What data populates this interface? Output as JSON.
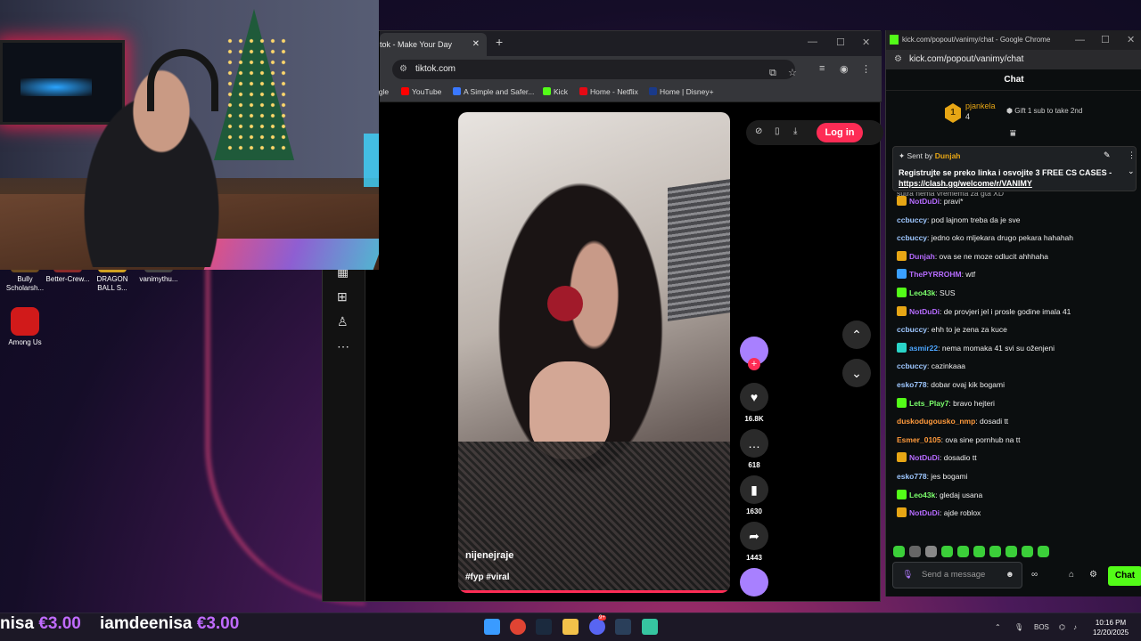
{
  "desktop": {
    "icons": [
      {
        "label": "Bully Scholarsh...",
        "color": "#6b4a1f"
      },
      {
        "label": "Better-Crew...",
        "color": "#8a2a2a"
      },
      {
        "label": "DRAGON BALL S...",
        "color": "#d0a020"
      },
      {
        "label": "vanimythu...",
        "color": "#444"
      },
      {
        "label": "Among Us",
        "color": "#d11a1a"
      }
    ]
  },
  "tiktok_browser": {
    "tab_title": "tok - Make Your Day",
    "url": "tiktok.com",
    "bookmarks": [
      "ogle",
      "YouTube",
      "A Simple and Safer...",
      "Kick",
      "Home - Netflix",
      "Home | Disney+"
    ],
    "login_label": "Log in",
    "video": {
      "username": "nijenejraje",
      "hashtags": "#fyp #viral"
    },
    "counts": {
      "likes": "16.8K",
      "comments": "618",
      "saves": "1630",
      "shares": "1443"
    }
  },
  "chat_window": {
    "window_title": "kick.com/popout/vanimy/chat - Google Chrome",
    "url": "kick.com/popout/vanimy/chat",
    "heading": "Chat",
    "leaderboard": {
      "rank": "1",
      "name": "pjankela",
      "count": "4",
      "gift_text": "Gift 1 sub to take 2nd"
    },
    "pinned": {
      "sent_by_label": "Sent by",
      "sender": "Dunjah",
      "message": "Registrujte se preko linka i osvojite 3 FREE CS CASES",
      "link_prefix": "- ",
      "link": "https://clash.gg/welcome/r/VANIMY"
    },
    "partial_line": "sutra nema vremema za gta XD",
    "messages": [
      {
        "user": "NotDuDi",
        "color": "#b66bff",
        "badge": "#e7a615",
        "text": ": pravi*"
      },
      {
        "user": "ccbuccy",
        "color": "#9ec7ff",
        "badge": "",
        "text": ": pod lajnom treba da je sve"
      },
      {
        "user": "ccbuccy",
        "color": "#9ec7ff",
        "badge": "",
        "text": ": jedno oko mljekara drugo pekara hahahah"
      },
      {
        "user": "Dunjah",
        "color": "#b66bff",
        "badge": "#e7a615",
        "text": ": ova se ne moze odlucit ahhhaha"
      },
      {
        "user": "ThePYRROHM",
        "color": "#b66bff",
        "badge": "#3aa0ff",
        "text": ": wtf"
      },
      {
        "user": "Leo43k",
        "color": "#7bff6b",
        "badge": "#53fc18",
        "text": ": SUS"
      },
      {
        "user": "NotDuDi",
        "color": "#b66bff",
        "badge": "#e7a615",
        "text": ": de provjeri jel i prosle godine imala 41"
      },
      {
        "user": "ccbuccy",
        "color": "#9ec7ff",
        "badge": "",
        "text": ": ehh to je zena za kuce"
      },
      {
        "user": "asmir22",
        "color": "#4da6ff",
        "badge": "#2ad4c8",
        "text": ": nema momaka 41 svi su oženjeni"
      },
      {
        "user": "ccbuccy",
        "color": "#9ec7ff",
        "badge": "",
        "text": ": cazinkaaa"
      },
      {
        "user": "esko778",
        "color": "#9ec7ff",
        "badge": "",
        "text": ": dobar ovaj kik bogami"
      },
      {
        "user": "Lets_Play7",
        "color": "#7bff6b",
        "badge": "#53fc18",
        "text": ": bravo hejteri"
      },
      {
        "user": "duskodugousko_nmp",
        "color": "#ff9a3c",
        "badge": "",
        "text": ": dosadi tt"
      },
      {
        "user": "Esmer_0105",
        "color": "#ff9a3c",
        "badge": "",
        "text": ": ova sine pornhub na tt"
      },
      {
        "user": "NotDuDi",
        "color": "#b66bff",
        "badge": "#e7a615",
        "text": ": dosadio tt"
      },
      {
        "user": "esko778",
        "color": "#9ec7ff",
        "badge": "",
        "text": ": jes bogami"
      },
      {
        "user": "Leo43k",
        "color": "#7bff6b",
        "badge": "#53fc18",
        "text": ": gledaj usana"
      },
      {
        "user": "NotDuDi",
        "color": "#b66bff",
        "badge": "#e7a615",
        "text": ": ajde roblox"
      }
    ],
    "input_placeholder": "Send a message",
    "send_label": "Chat"
  },
  "ticker": {
    "items": [
      {
        "name": "nisa",
        "amount": "€3.00"
      },
      {
        "name": "iamdeenisa",
        "amount": "€3.00"
      }
    ]
  },
  "taskbar": {
    "lang": "BOS",
    "time": "10:16 PM",
    "date": "12/20/2025",
    "discord_badge": "9+"
  }
}
